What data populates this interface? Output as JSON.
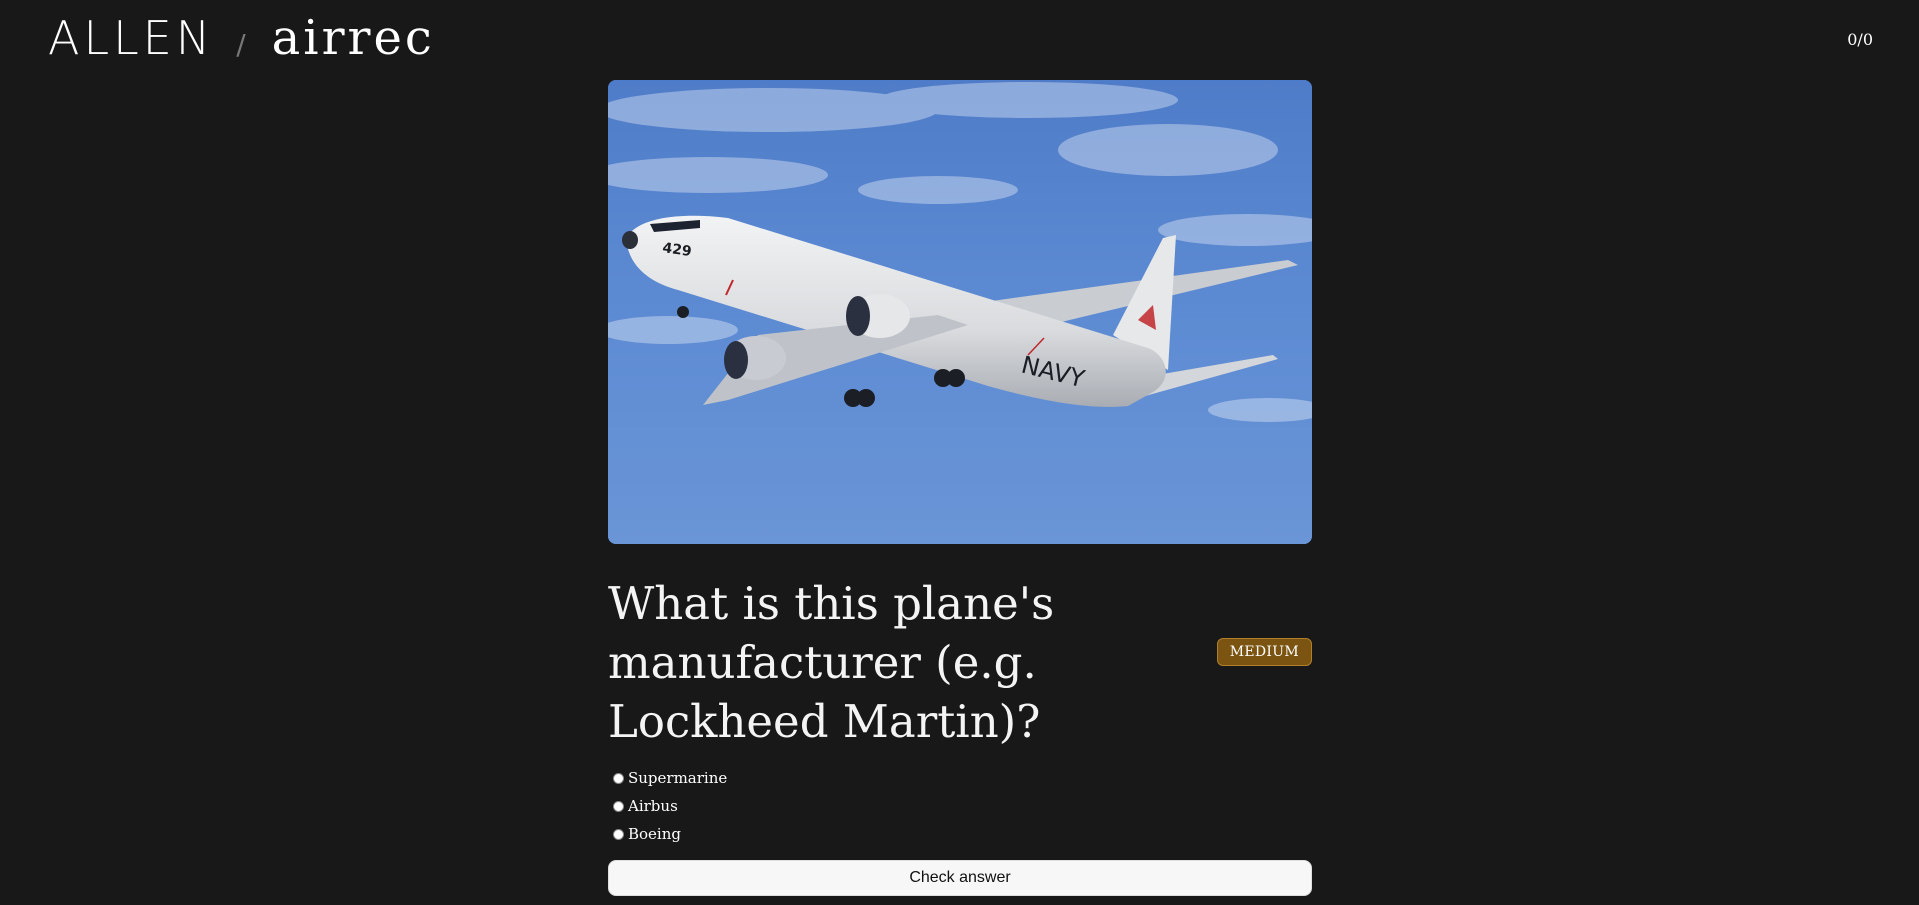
{
  "header": {
    "brand": "ALLEN",
    "separator": "/",
    "app_name": "airrec",
    "score": "0/0"
  },
  "photo": {
    "subject": "aircraft-photo",
    "sky_color": "#5c8ad0",
    "markings": {
      "nose_number": "429",
      "fuselage_text": "NAVY"
    }
  },
  "question": {
    "text": "What is this plane's manufacturer (e.g. Lockheed Martin)?",
    "difficulty": "MEDIUM",
    "difficulty_color": "#7a5410"
  },
  "options": [
    {
      "label": "Supermarine",
      "selected": false
    },
    {
      "label": "Airbus",
      "selected": false
    },
    {
      "label": "Boeing",
      "selected": false
    }
  ],
  "actions": {
    "check_label": "Check answer"
  }
}
